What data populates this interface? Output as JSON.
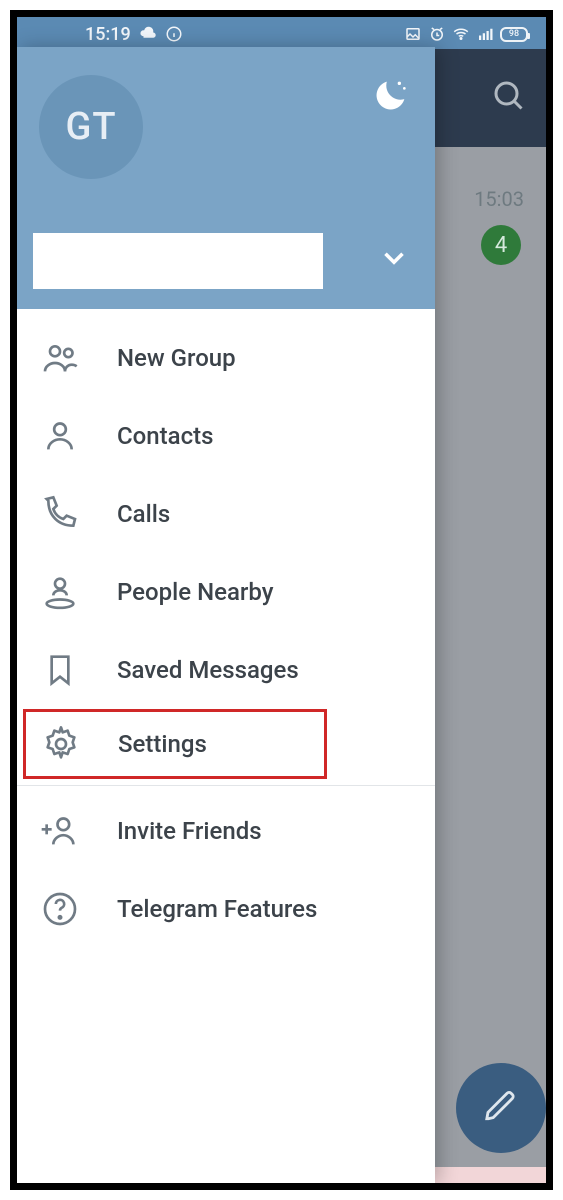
{
  "status": {
    "time": "15:19",
    "battery": "98"
  },
  "background": {
    "chat_time": "15:03",
    "badge_count": "4"
  },
  "drawer": {
    "avatar_initials": "GT",
    "menu": [
      {
        "label": "New Group"
      },
      {
        "label": "Contacts"
      },
      {
        "label": "Calls"
      },
      {
        "label": "People Nearby"
      },
      {
        "label": "Saved Messages"
      },
      {
        "label": "Settings"
      },
      {
        "label": "Invite Friends"
      },
      {
        "label": "Telegram Features"
      }
    ]
  }
}
